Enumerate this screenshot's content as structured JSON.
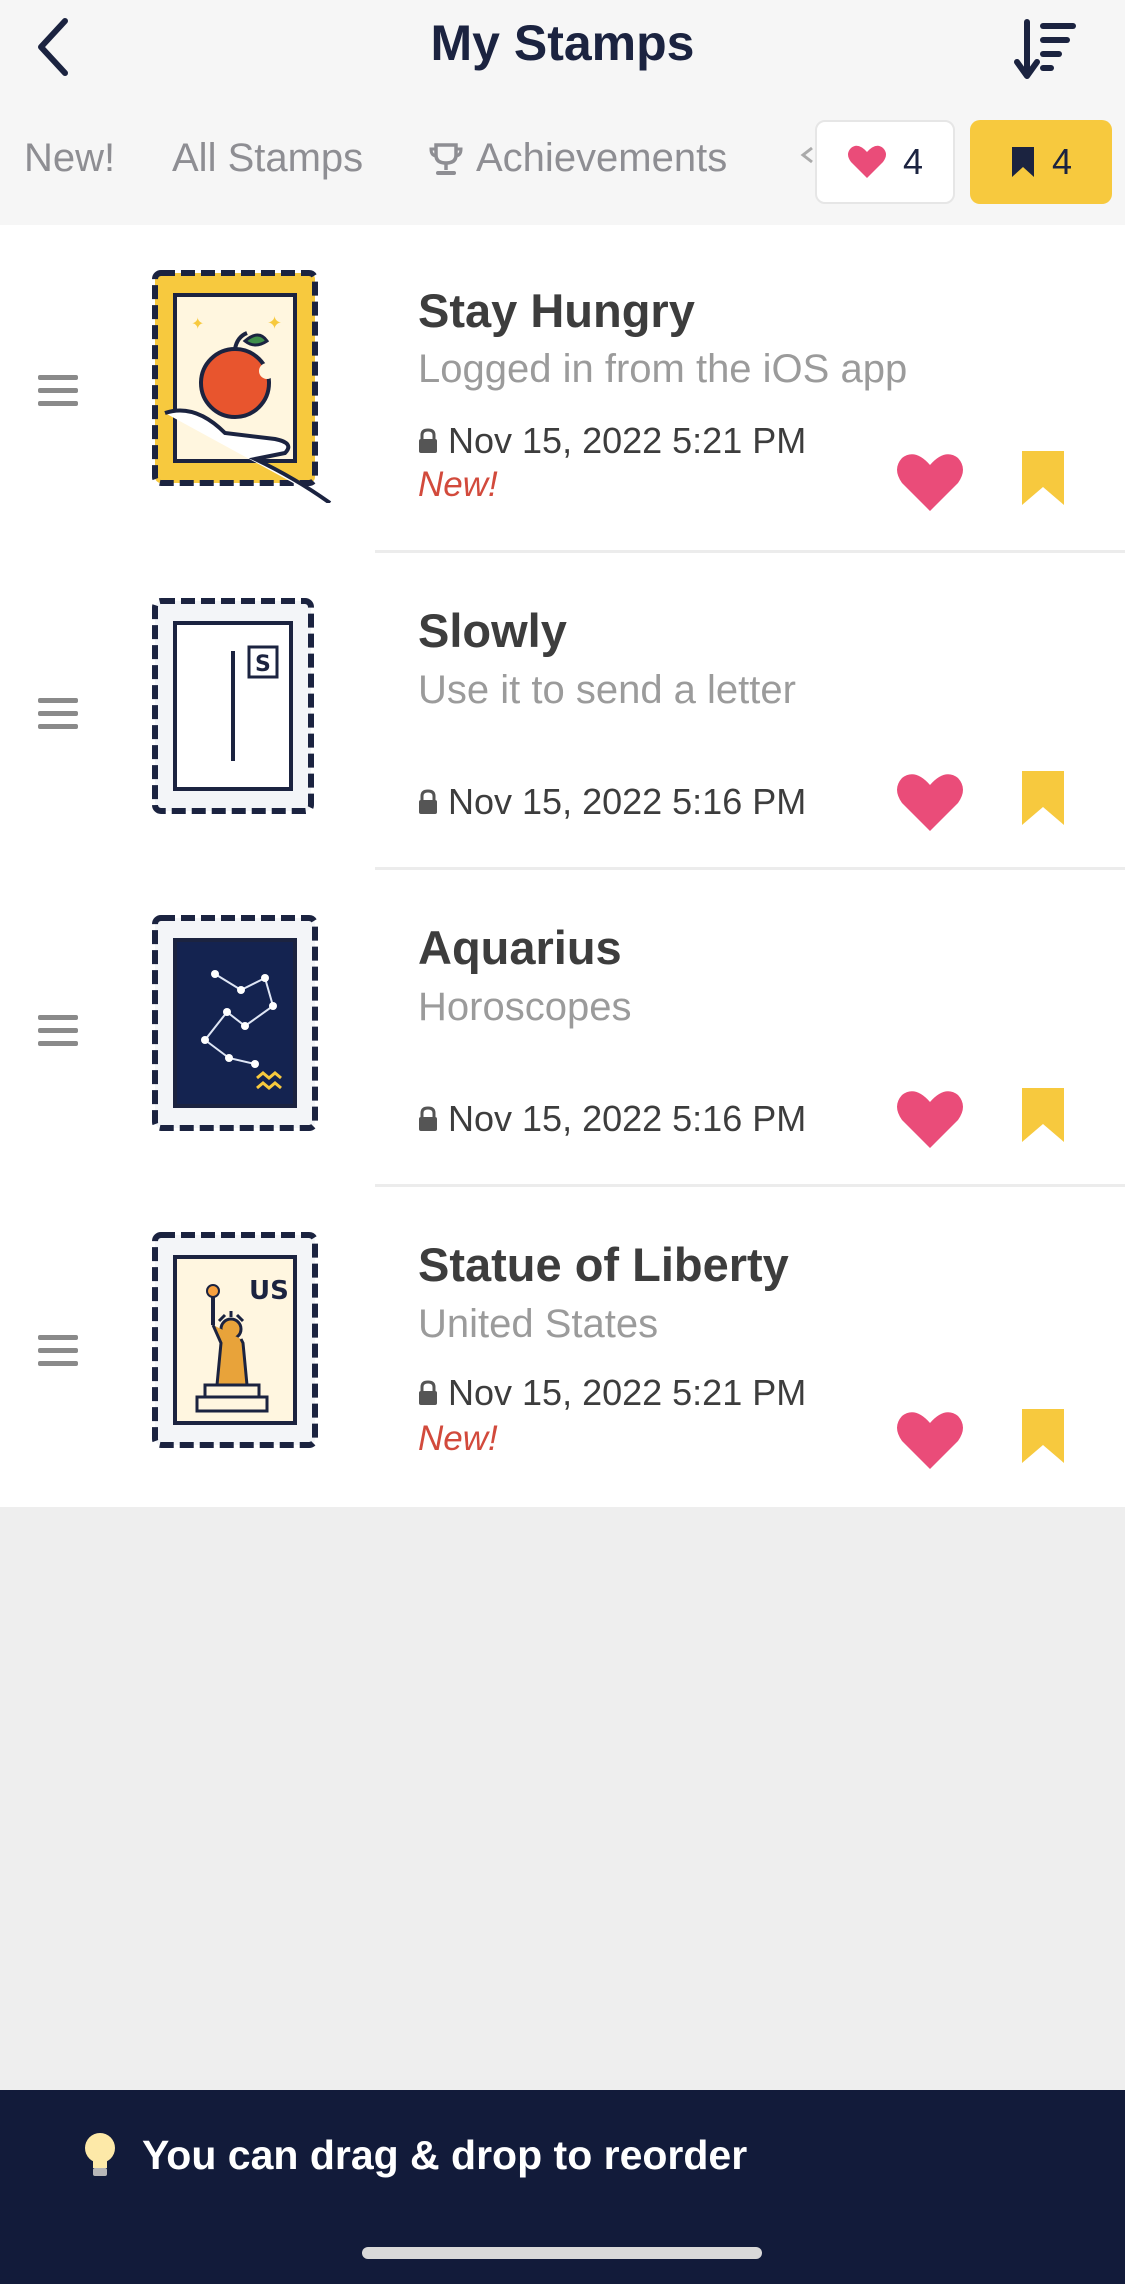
{
  "header": {
    "title": "My Stamps",
    "back_icon": "chevron-left-icon",
    "sort_icon": "sort-descending-icon"
  },
  "tabs": [
    {
      "label": "New!"
    },
    {
      "label": "All Stamps"
    },
    {
      "label": "Achievements",
      "icon": "trophy-icon"
    }
  ],
  "filters": {
    "favorites_count": "4",
    "saved_count": "4"
  },
  "stamps": [
    {
      "name": "Stay Hungry",
      "description": "Logged in from the iOS app",
      "date": "Nov 15, 2022 5:21 PM",
      "new_label": "New!"
    },
    {
      "name": "Slowly",
      "description": "Use it to send a letter",
      "date": "Nov 15, 2022 5:16 PM"
    },
    {
      "name": "Aquarius",
      "description": "Horoscopes",
      "date": "Nov 15, 2022 5:16 PM"
    },
    {
      "name": "Statue of Liberty",
      "description": "United States",
      "date": "Nov 15, 2022 5:21 PM",
      "new_label": "New!"
    }
  ],
  "stamp_labels": {
    "slowly_badge": "S",
    "liberty_country": "US"
  },
  "footer": {
    "hint": "You can drag & drop to reorder",
    "hint_icon": "lightbulb-icon"
  },
  "colors": {
    "accent_yellow": "#f7c93e",
    "heart_pink": "#ea4c79",
    "navy": "#121b3a",
    "new_red": "#d24a3c"
  }
}
